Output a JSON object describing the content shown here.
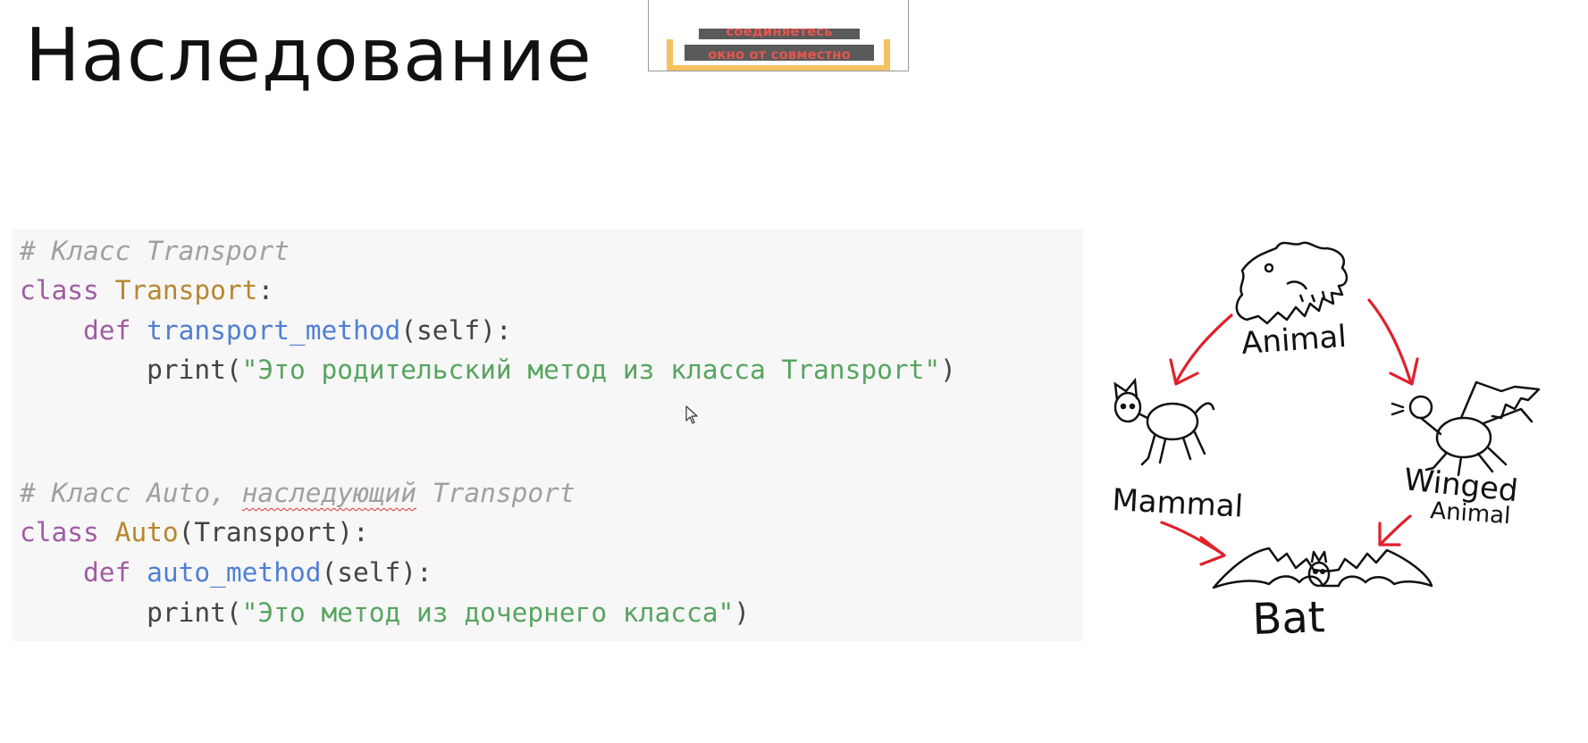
{
  "slide": {
    "title": "Наследование"
  },
  "overlay": {
    "line1": "соединяетесь",
    "line2": "окно от совместно"
  },
  "code": {
    "comment1": "# Класс Transport",
    "kw_class": "class",
    "transport_name": "Transport",
    "colon": ":",
    "kw_def": "def",
    "transport_method": "transport_method",
    "self_sig": "(self):",
    "print_kw": "print",
    "open_paren": "(",
    "close_paren": ")",
    "string1": "\"Это родительский метод из класса Transport\"",
    "comment2_prefix": "# Класс Auto, ",
    "comment2_squiggle": "наследующий",
    "comment2_suffix": " Transport",
    "auto_name": "Auto",
    "auto_parent": "(Transport):",
    "auto_method": "auto_method",
    "string2": "\"Это метод из дочернего класса\""
  },
  "diagram": {
    "labels": {
      "animal": "Animal",
      "mammal": "Mammal",
      "winged_1": "Winged",
      "winged_2": "Animal",
      "bat": "Bat"
    },
    "arrow_color": "#e0202a",
    "icons": [
      "dragon-icon",
      "cat-icon",
      "bird-icon",
      "bat-icon"
    ]
  },
  "colors": {
    "comment": "#a0a0a0",
    "keyword": "#a15ba3",
    "class_name": "#b8862f",
    "function": "#4f7fd4",
    "string": "#57a55f",
    "code_bg": "#f7f7f7"
  }
}
